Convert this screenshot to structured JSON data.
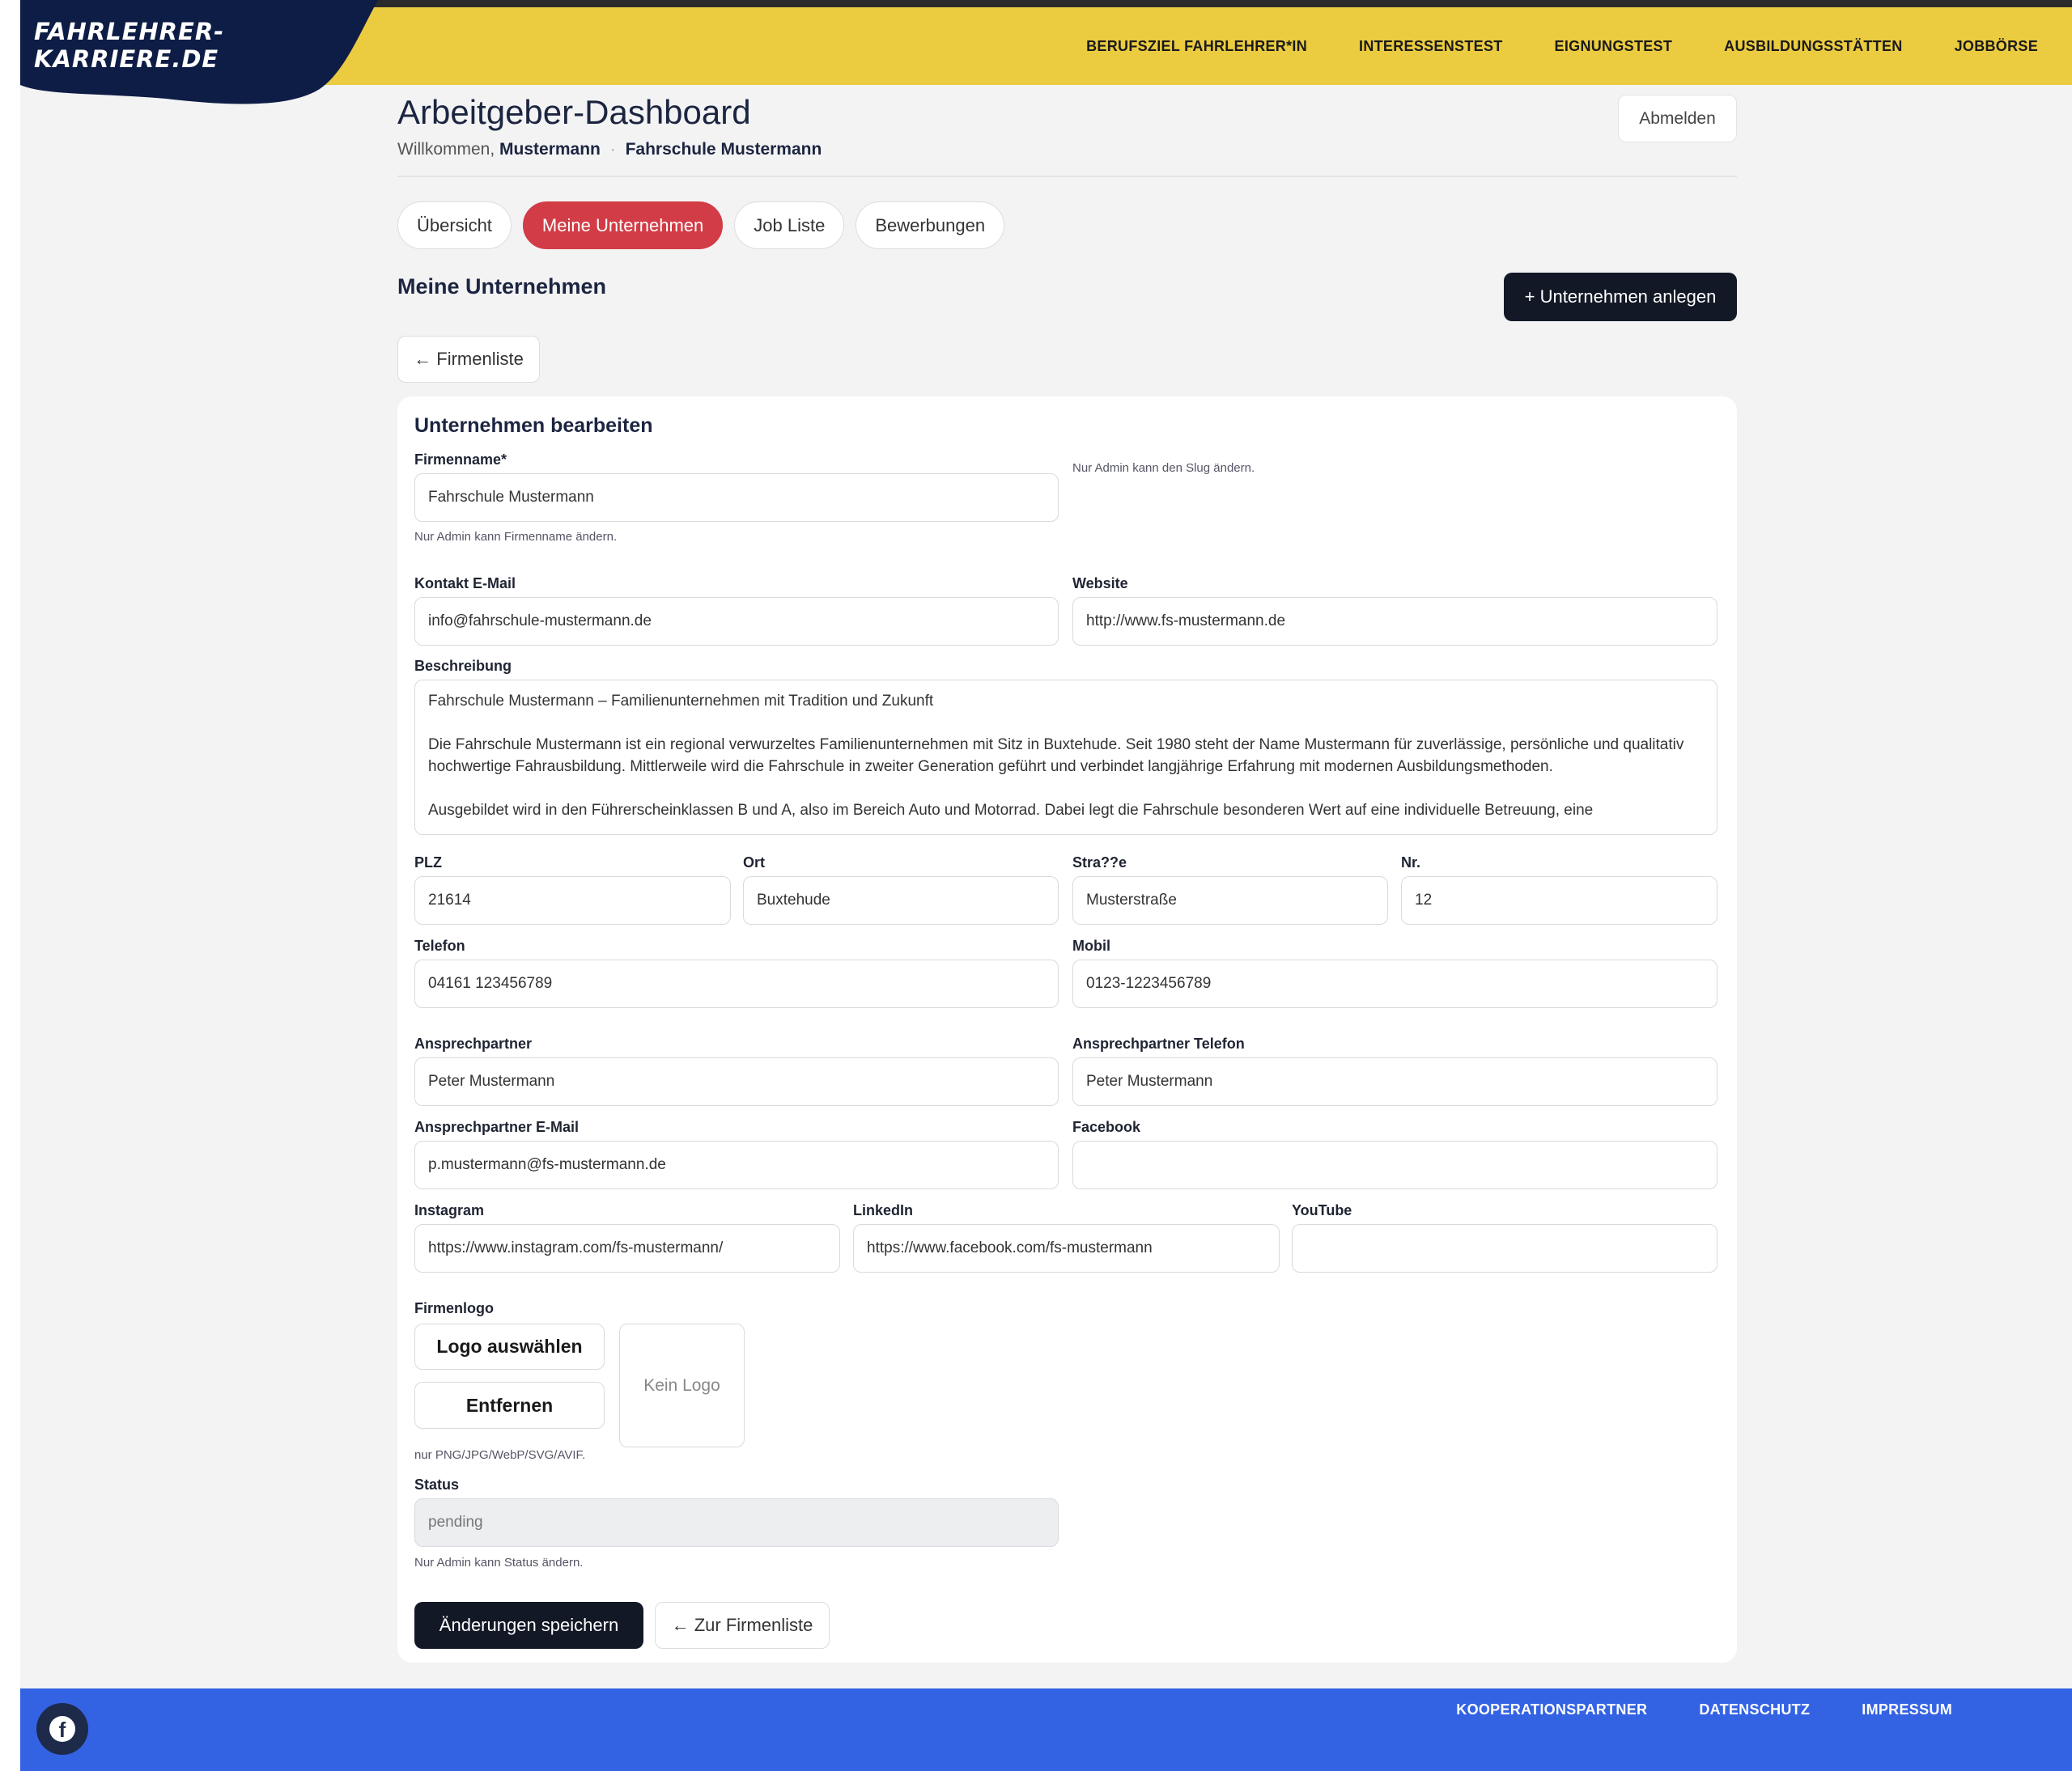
{
  "header": {
    "logo_text": "FAHRLEHRER-KARRIERE.DE",
    "nav": [
      "BERUFSZIEL FAHRLEHRER*IN",
      "INTERESSENSTEST",
      "EIGNUNGSTEST",
      "AUSBILDUNGSSTÄTTEN",
      "JOBBÖRSE"
    ]
  },
  "dashboard": {
    "title": "Arbeitgeber-Dashboard",
    "welcome_prefix": "Willkommen,",
    "user_name": "Mustermann",
    "separator": "·",
    "company_name": "Fahrschule Mustermann",
    "logout_label": "Abmelden"
  },
  "tabs": [
    {
      "label": "Übersicht",
      "active": false
    },
    {
      "label": "Meine Unternehmen",
      "active": true
    },
    {
      "label": "Job Liste",
      "active": false
    },
    {
      "label": "Bewerbungen",
      "active": false
    }
  ],
  "section": {
    "title": "Meine Unternehmen",
    "create_label": "+ Unternehmen anlegen",
    "back_label": "← Firmenliste"
  },
  "form": {
    "title": "Unternehmen bearbeiten",
    "firmenname": {
      "label": "Firmenname*",
      "value": "Fahrschule Mustermann",
      "hint": "Nur Admin kann Firmenname ändern."
    },
    "slug_hint": "Nur Admin kann den Slug ändern.",
    "kontakt_email": {
      "label": "Kontakt E-Mail",
      "value": "info@fahrschule-mustermann.de"
    },
    "website": {
      "label": "Website",
      "value": "http://www.fs-mustermann.de"
    },
    "beschreibung": {
      "label": "Beschreibung",
      "line1": "Fahrschule Mustermann – Familienunternehmen mit Tradition und Zukunft",
      "line2": "Die Fahrschule Mustermann ist ein regional verwurzeltes Familienunternehmen mit Sitz in Buxtehude. Seit 1980 steht der Name Mustermann für zuverlässige, persönliche und qualitativ hochwertige Fahrausbildung. Mittlerweile wird die Fahrschule in zweiter Generation geführt und verbindet langjährige Erfahrung mit modernen Ausbildungsmethoden.",
      "line3": "Ausgebildet wird in den Führerscheinklassen B und A, also im Bereich Auto und Motorrad. Dabei legt die Fahrschule besonderen Wert auf eine individuelle Betreuung, eine"
    },
    "plz": {
      "label": "PLZ",
      "value": "21614"
    },
    "ort": {
      "label": "Ort",
      "value": "Buxtehude"
    },
    "strasse": {
      "label": "Stra??e",
      "value": "Musterstraße"
    },
    "nr": {
      "label": "Nr.",
      "value": "12"
    },
    "telefon": {
      "label": "Telefon",
      "value": "04161 123456789"
    },
    "mobil": {
      "label": "Mobil",
      "value": "0123-1223456789"
    },
    "ansprechpartner": {
      "label": "Ansprechpartner",
      "value": "Peter Mustermann"
    },
    "ansprechpartner_telefon": {
      "label": "Ansprechpartner Telefon",
      "value": "Peter Mustermann"
    },
    "ansprechpartner_email": {
      "label": "Ansprechpartner E-Mail",
      "value": "p.mustermann@fs-mustermann.de"
    },
    "facebook": {
      "label": "Facebook",
      "value": ""
    },
    "instagram": {
      "label": "Instagram",
      "value": "https://www.instagram.com/fs-mustermann/"
    },
    "linkedin": {
      "label": "LinkedIn",
      "value": "https://www.facebook.com/fs-mustermann"
    },
    "youtube": {
      "label": "YouTube",
      "value": ""
    },
    "firmenlogo": {
      "label": "Firmenlogo",
      "select_label": "Logo auswählen",
      "remove_label": "Entfernen",
      "placeholder": "Kein Logo",
      "hint": "nur PNG/JPG/WebP/SVG/AVIF."
    },
    "status": {
      "label": "Status",
      "value": "pending",
      "hint": "Nur Admin kann Status ändern."
    },
    "save_label": "Änderungen speichern",
    "back_list_label": "← Zur Firmenliste"
  },
  "footer": {
    "links": [
      "KOOPERATIONSPARTNER",
      "DATENSCHUTZ",
      "IMPRESSUM"
    ],
    "facebook_icon": "facebook-icon"
  },
  "colors": {
    "header_bg": "#ebcb40",
    "active_tab": "#d23c46",
    "dark_button": "#121826",
    "footer_bg": "#3362e3"
  }
}
